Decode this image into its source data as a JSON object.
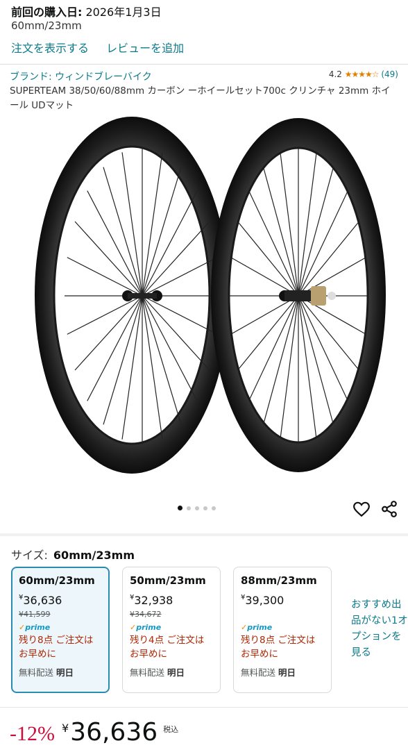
{
  "purchase": {
    "label": "前回の購入日:",
    "date": "2026年1月3日",
    "variant": "60mm/23mm",
    "view_order": "注文を表示する",
    "add_review": "レビューを追加"
  },
  "product": {
    "brand": "ブランド: ウィンドブレーバイク",
    "rating_value": "4.2",
    "rating_stars": "★★★★☆",
    "rating_count": "(49)",
    "rating_fraction": 0.84,
    "title": "SUPERTEAM 38/50/60/88mm カーボン ーホイールセット700c クリンチャ 23mm ホイール UDマット"
  },
  "carousel": {
    "count": 5,
    "active_index": 0
  },
  "size": {
    "label": "サイズ:",
    "selected": "60mm/23mm",
    "options": [
      {
        "size": "60mm/23mm",
        "yen": "¥",
        "price": "36,636",
        "list_price": "¥41,599",
        "prime": "prime",
        "stock": "残り8点 ご注文はお早めに",
        "ship_label": "無料配送",
        "ship_day": "明日"
      },
      {
        "size": "50mm/23mm",
        "yen": "¥",
        "price": "32,938",
        "list_price": "¥34,672",
        "prime": "prime",
        "stock": "残り4点 ご注文はお早めに",
        "ship_label": "無料配送",
        "ship_day": "明日"
      },
      {
        "size": "88mm/23mm",
        "yen": "¥",
        "price": "39,300",
        "prime": "prime",
        "stock": "残り8点 ご注文はお早めに",
        "ship_label": "無料配送",
        "ship_day": "明日"
      }
    ],
    "more_options": "おすすめ出品がない1オプションを見る"
  },
  "buybox": {
    "discount": "-12%",
    "yen": "¥",
    "price": "36,636",
    "tax": "税込"
  },
  "colors": {
    "link": "#0a7a8a",
    "star": "#e07f00",
    "deal_red": "#cc0c39",
    "stock_red": "#b12704",
    "prime_blue": "#1399c6",
    "selected_border": "#2a8bb0"
  },
  "icons": {
    "favorite": "heart-icon",
    "share": "share-icon"
  }
}
